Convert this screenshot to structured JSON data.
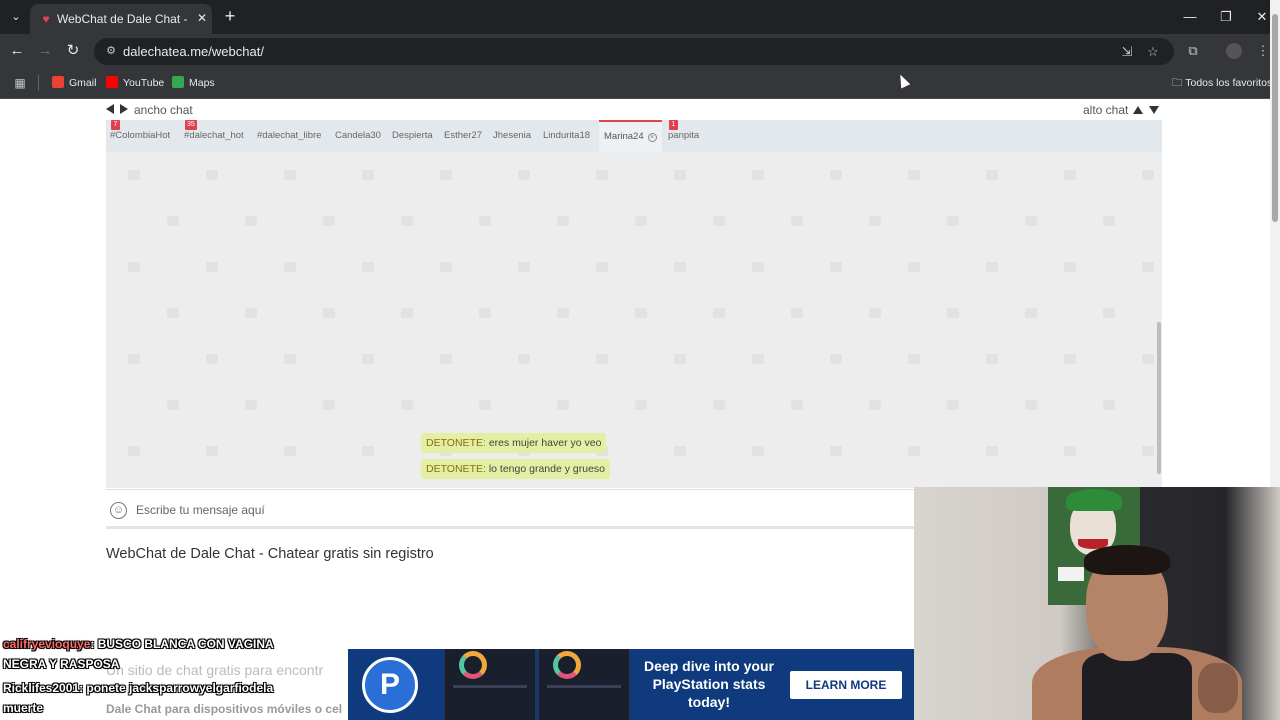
{
  "browser": {
    "tab_title": "WebChat de Dale Chat - Chatea",
    "url": "dalechatea.me/webchat/",
    "bookmarks": [
      {
        "label": "Gmail",
        "color": "#ea4335"
      },
      {
        "label": "YouTube",
        "color": "#ff0000"
      },
      {
        "label": "Maps",
        "color": "#34a853"
      }
    ],
    "bookmarks_folder": "Todos los favoritos"
  },
  "chat": {
    "width_label": "ancho chat",
    "height_label": "alto chat",
    "tabs": [
      {
        "label": "#ColombiaHot",
        "badge": "7"
      },
      {
        "label": "#dalechat_hot",
        "badge": "35"
      },
      {
        "label": "#dalechat_libre",
        "badge": ""
      },
      {
        "label": "Candela30",
        "badge": ""
      },
      {
        "label": "Despierta",
        "badge": ""
      },
      {
        "label": "Esther27",
        "badge": ""
      },
      {
        "label": "Jhesenia",
        "badge": ""
      },
      {
        "label": "Lindurita18",
        "badge": ""
      },
      {
        "label": "Marina24",
        "badge": "",
        "active": true
      },
      {
        "label": "panpita",
        "badge": "1"
      }
    ],
    "messages": [
      {
        "nick": "DETONETE:",
        "text": "eres mujer haver yo veo"
      },
      {
        "nick": "DETONETE:",
        "text": "lo tengo grande y grueso"
      }
    ],
    "input_placeholder": "Escribe tu mensaje aquí"
  },
  "page": {
    "heading": "WebChat de Dale Chat - Chatear gratis sin registro",
    "subline": "Un sitio de chat gratis para encontr",
    "subline2": "Dale Chat para dispositivos móviles o cel"
  },
  "stream_overlay": {
    "comments": [
      {
        "user": "califryevioquye",
        "text": ": BUSCO BLANCA CON VAGINA"
      },
      {
        "user": "",
        "text": "NEGRA Y RASPOSA"
      },
      {
        "user": "Ricklifes2001",
        "text": ": ponete jacksparrowyelgarfiodela"
      },
      {
        "user": "",
        "text": "muerte"
      }
    ],
    "ad": {
      "headline": "Deep dive into your PlayStation stats today!",
      "cta": "LEARN MORE"
    }
  },
  "colors": {
    "accent_red": "#e0404f",
    "message_bg": "#e3f0a3",
    "ad_bg": "#0f3a7d"
  }
}
